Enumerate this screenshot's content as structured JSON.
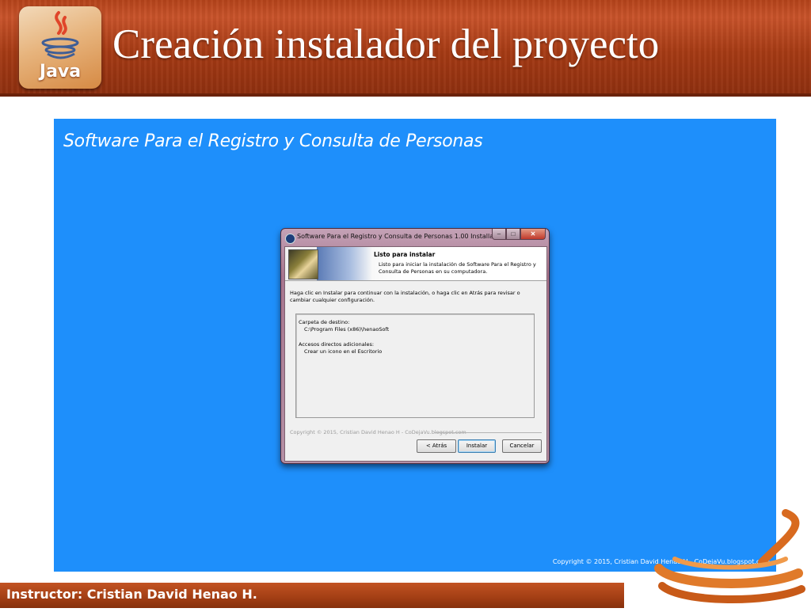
{
  "slide": {
    "title": "Creación instalador del proyecto",
    "logo_text": "Java",
    "footer": "Instructor: Cristian David Henao H."
  },
  "installer_screen": {
    "heading": "Software Para el Registro y Consulta de Personas",
    "copyright": "Copyright © 2015, Cristian David Henao H - CoDejaVu.blogspot.com"
  },
  "dialog": {
    "window_title": "Software Para el Registro y Consulta de Personas 1.00 Installation",
    "window_buttons": {
      "minimize": "–",
      "maximize": "□",
      "close": "✕"
    },
    "header_title": "Listo para instalar",
    "header_desc": "Listo para iniciar la instalación de Software Para el Registro y Consulta de Personas en su computadora.",
    "intro": "Haga clic en Instalar para continuar con la instalación, o haga clic en Atrás para revisar o cambiar cualquier configuración.",
    "memo": {
      "dest_label": "Carpeta de destino:",
      "dest_value": "C:\\Program Files (x86)\\henaoSoft",
      "shortcuts_label": "Accesos directos adicionales:",
      "shortcuts_value": "Crear un icono en el Escritorio"
    },
    "copyright": "Copyright © 2015, Cristian David Henao H - CoDejaVu.blogspot.com",
    "buttons": {
      "back": "< Atrás",
      "install": "Instalar",
      "cancel": "Cancelar"
    }
  },
  "colors": {
    "header": "#a53a14",
    "screen": "#1e8ffb",
    "footer": "#a23e14"
  }
}
